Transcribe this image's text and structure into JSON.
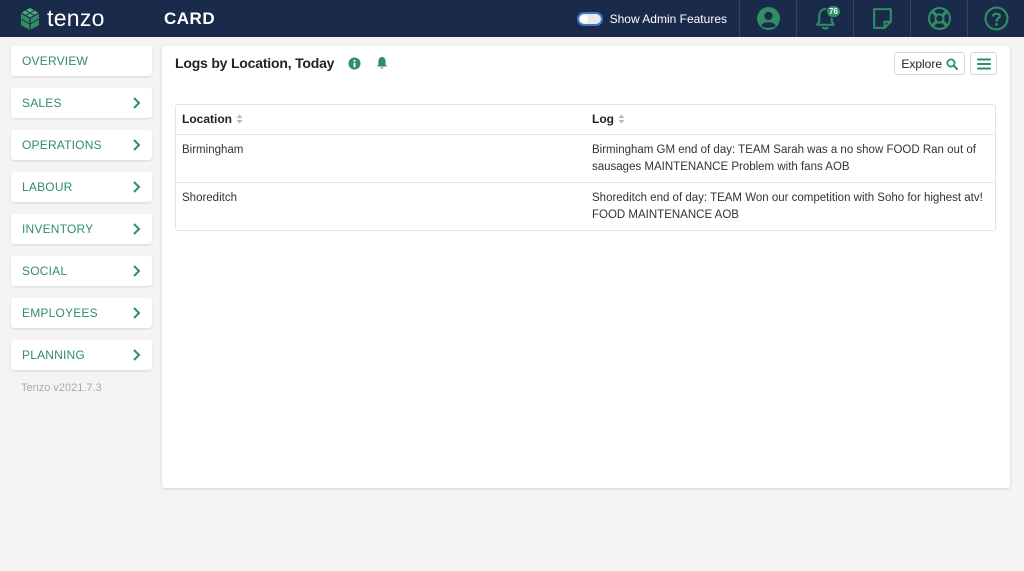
{
  "header": {
    "logo_text": "tenzo",
    "page_title": "CARD",
    "admin_toggle_label": "Show Admin Features",
    "notification_count": "76"
  },
  "sidebar": {
    "items": [
      {
        "label": "OVERVIEW",
        "has_chevron": false
      },
      {
        "label": "SALES",
        "has_chevron": true
      },
      {
        "label": "OPERATIONS",
        "has_chevron": true
      },
      {
        "label": "LABOUR",
        "has_chevron": true
      },
      {
        "label": "INVENTORY",
        "has_chevron": true
      },
      {
        "label": "SOCIAL",
        "has_chevron": true
      },
      {
        "label": "EMPLOYEES",
        "has_chevron": true
      },
      {
        "label": "PLANNING",
        "has_chevron": true
      }
    ],
    "version": "Tenzo v2021.7.3"
  },
  "card": {
    "title": "Logs by Location, Today",
    "explore_label": "Explore",
    "table": {
      "columns": [
        "Location",
        "Log"
      ],
      "rows": [
        {
          "location": "Birmingham",
          "log": "Birmingham GM end of day: TEAM Sarah was a no show FOOD Ran out of sausages MAINTENANCE Problem with fans AOB"
        },
        {
          "location": "Shoreditch",
          "log": "Shoreditch end of day: TEAM Won our competition with Soho for highest atv! FOOD MAINTENANCE AOB"
        }
      ]
    }
  },
  "colors": {
    "topbar": "#1a2a4a",
    "accent_green": "#2f8f62",
    "toggle_border": "#3a78c9"
  },
  "icons": {
    "logo": "hexagon-logo-icon",
    "profile": "user-circle-icon",
    "notifications": "bell-icon",
    "notes": "note-icon",
    "support": "life-ring-icon",
    "help": "question-circle-icon",
    "info": "info-icon",
    "alert": "bell-icon",
    "explore": "search-icon",
    "menu": "hamburger-menu-icon",
    "nav": "chevron-right-icon",
    "sort": "sort-icon"
  }
}
